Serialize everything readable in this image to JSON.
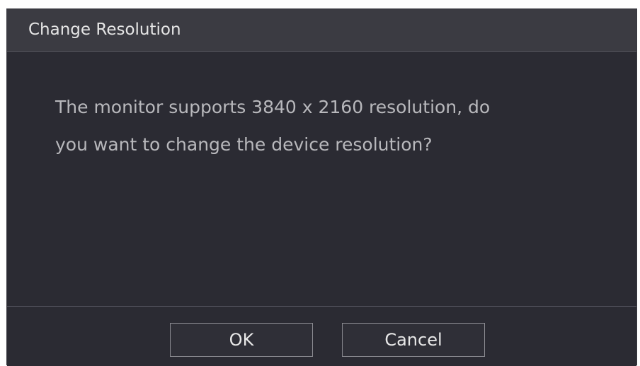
{
  "dialog": {
    "title": "Change Resolution",
    "message_line1": "The monitor supports 3840 x 2160 resolution, do",
    "message_line2": "you want to change the device resolution?",
    "ok_label": "OK",
    "cancel_label": "Cancel"
  }
}
